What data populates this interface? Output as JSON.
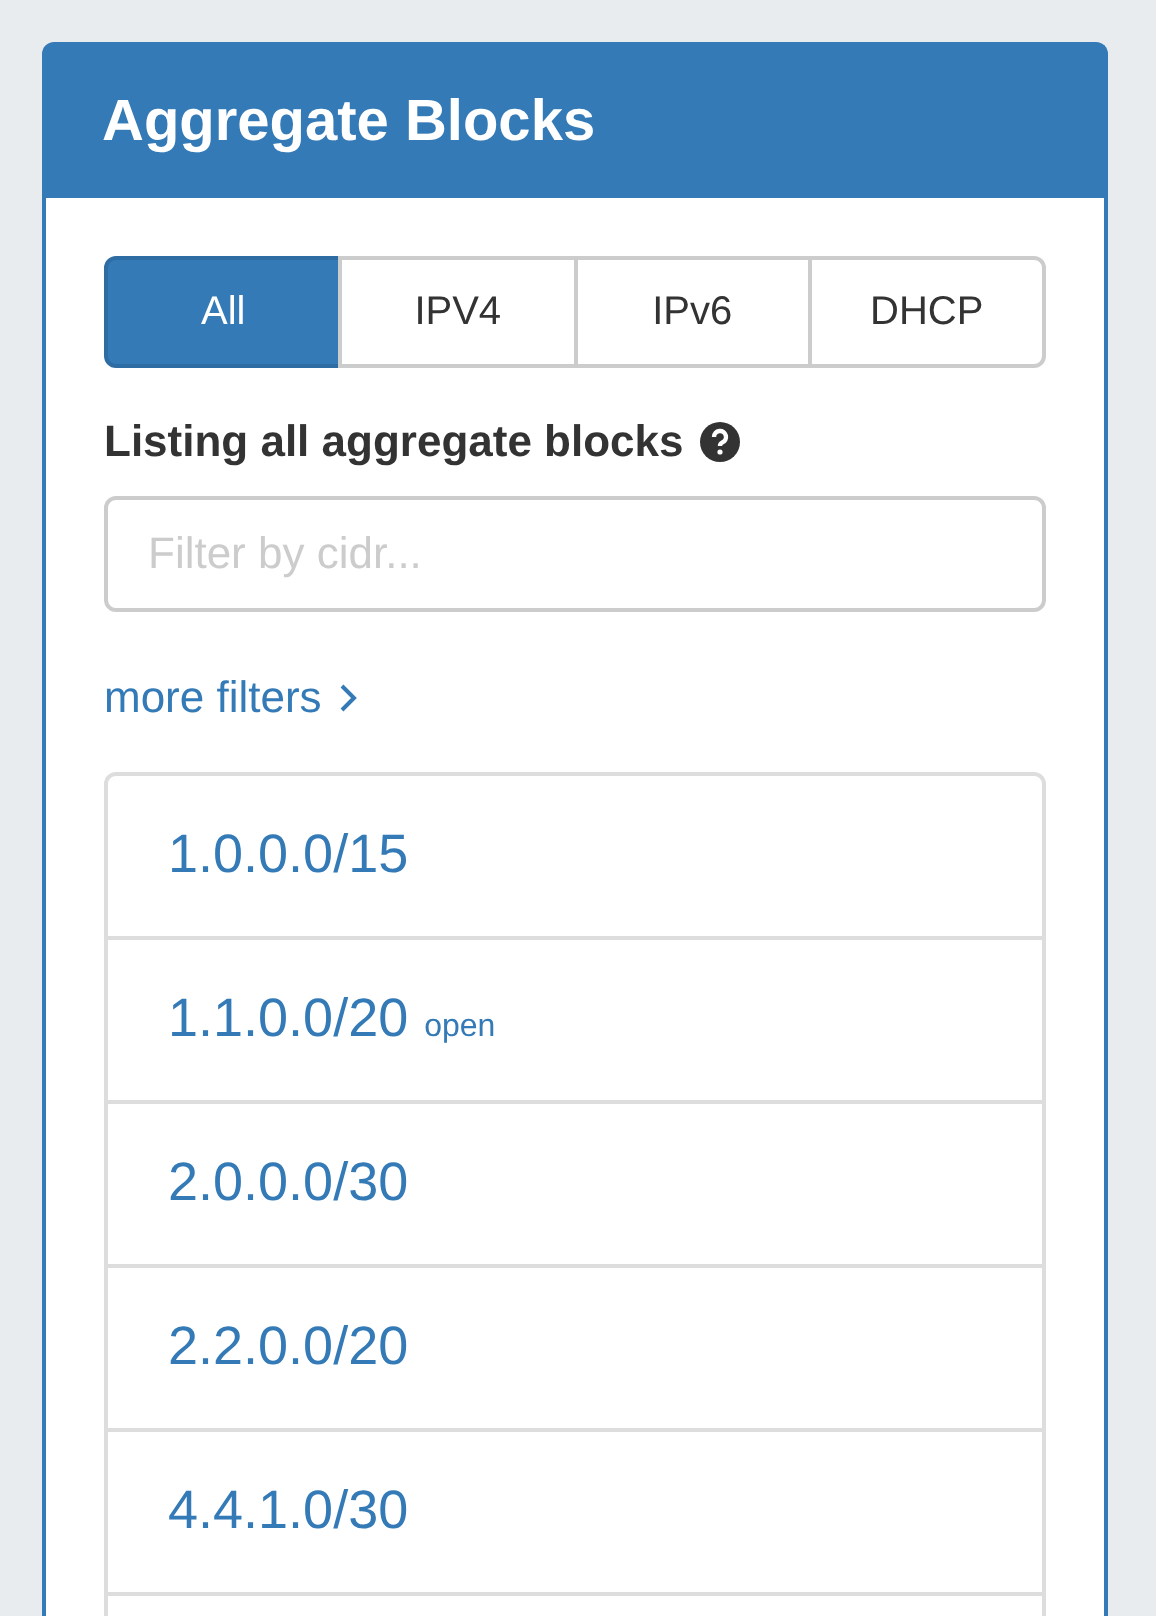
{
  "panel": {
    "title": "Aggregate Blocks"
  },
  "tabs": [
    {
      "label": "All",
      "selected": true
    },
    {
      "label": "IPV4",
      "selected": false
    },
    {
      "label": "IPv6",
      "selected": false
    },
    {
      "label": "DHCP",
      "selected": false
    }
  ],
  "listing_label": "Listing all aggregate blocks",
  "filter": {
    "placeholder": "Filter by cidr..."
  },
  "more_filters": "more filters",
  "blocks": [
    {
      "cidr": "1.0.0.0/15"
    },
    {
      "cidr": "1.1.0.0/20",
      "status": "open"
    },
    {
      "cidr": "2.0.0.0/30"
    },
    {
      "cidr": "2.2.0.0/20"
    },
    {
      "cidr": "4.4.1.0/30"
    }
  ]
}
